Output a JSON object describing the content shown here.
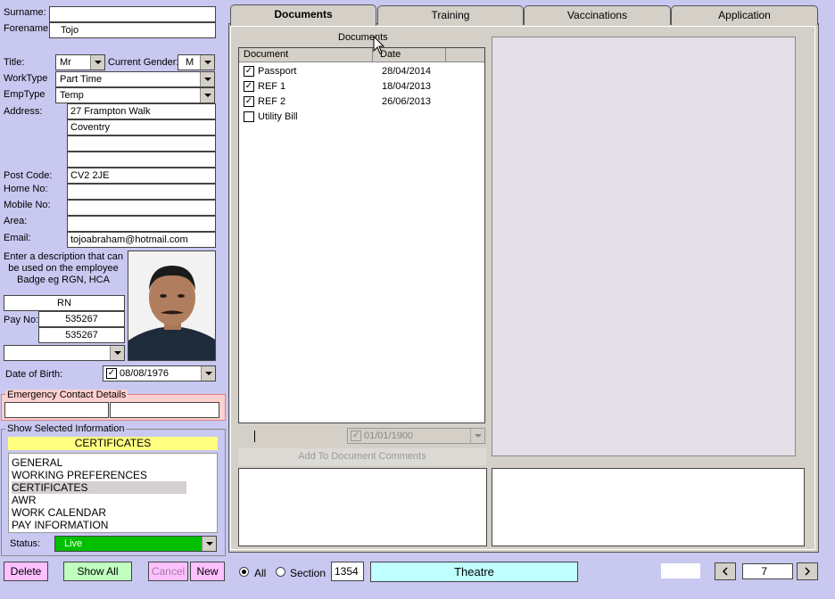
{
  "personal": {
    "surname_label": "Surname:",
    "surname_value": "",
    "forename_label": "Forename:",
    "forename_value": "Tojo",
    "title_label": "Title:",
    "title_value": "Mr",
    "gender_label": "Current Gender:",
    "gender_value": "M",
    "worktype_label": "WorkType",
    "worktype_value": "Part Time",
    "emptype_label": "EmpType",
    "emptype_value": "Temp",
    "address_label": "Address:",
    "address_lines": [
      "27 Frampton Walk",
      "Coventry",
      "",
      ""
    ],
    "postcode_label": "Post Code:",
    "postcode_value": "CV2 2JE",
    "homeno_label": "Home No:",
    "mobileno_label": "Mobile No:",
    "area_label": "Area:",
    "email_label": "Email:",
    "email_value": "tojoabraham@hotmail.com",
    "badge_hint": "Enter a description that can be used on the employee Badge eg RGN, HCA",
    "badge_value": "RN",
    "payno_label": "Pay No:",
    "payno_value_1": "535267",
    "payno_value_2": "535267",
    "dob_label": "Date of Birth:",
    "dob_value": "08/08/1976"
  },
  "emergency": {
    "title": "Emergency Contact Details"
  },
  "show_selected": {
    "title": "Show Selected Information",
    "header": "CERTIFICATES",
    "items": [
      "GENERAL",
      "WORKING PREFERENCES",
      "CERTIFICATES",
      "AWR",
      "WORK CALENDAR",
      "PAY INFORMATION"
    ],
    "status_label": "Status:",
    "status_value": "Live"
  },
  "tabs": [
    {
      "label": "Documents"
    },
    {
      "label": "Training"
    },
    {
      "label": "Vaccinations"
    },
    {
      "label": "Application"
    }
  ],
  "documents": {
    "heading": "Documents",
    "col_document": "Document",
    "col_date": "Date",
    "rows": [
      {
        "checked": true,
        "name": "Passport",
        "date": "28/04/2014"
      },
      {
        "checked": true,
        "name": "REF 1",
        "date": "18/04/2013"
      },
      {
        "checked": true,
        "name": "REF 2",
        "date": "26/06/2013"
      },
      {
        "checked": false,
        "name": "Utility Bill",
        "date": ""
      }
    ],
    "date_picker_value": "01/01/1900",
    "add_comments_label": "Add To Document Comments"
  },
  "footer": {
    "delete_label": "Delete",
    "show_all_label": "Show All",
    "cancel_label": "Cancel",
    "new_label": "New",
    "radio_all_label": "All",
    "radio_section_label": "Section",
    "section_code": "1354",
    "section_name": "Theatre",
    "record_number": "7"
  },
  "colors": {
    "background": "#c8c8f0",
    "tab_panel": "#d4d0c8",
    "status_live": "#00c000",
    "header_yellow": "#ffff80",
    "theatre_cyan": "#c0ffff",
    "delete_pink": "#ffc0ff",
    "showall_green": "#c0ffc0",
    "emergency_pink": "#ffd0d0"
  }
}
